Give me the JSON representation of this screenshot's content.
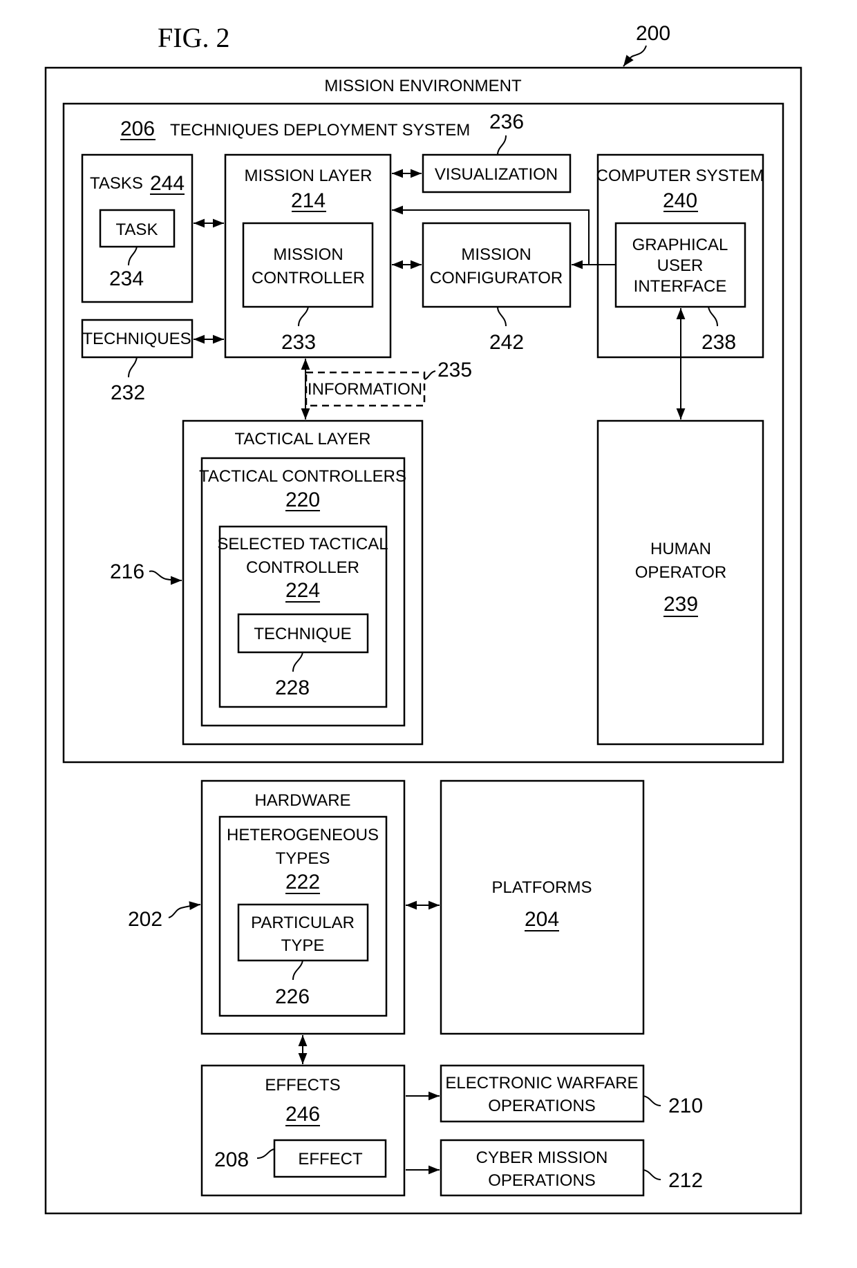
{
  "figure": {
    "title": "FIG. 2",
    "ref": "200"
  },
  "mission_environment": {
    "label": "MISSION ENVIRONMENT"
  },
  "techniques_deployment_system": {
    "ref": "206",
    "label": "TECHNIQUES DEPLOYMENT SYSTEM"
  },
  "tasks": {
    "label": "TASKS",
    "ref": "244",
    "task": {
      "label": "TASK",
      "ref": "234"
    }
  },
  "techniques": {
    "label": "TECHNIQUES",
    "ref": "232"
  },
  "mission_layer": {
    "label": "MISSION LAYER",
    "ref": "214",
    "mission_controller": {
      "line1": "MISSION",
      "line2": "CONTROLLER",
      "ref": "233"
    }
  },
  "visualization": {
    "label": "VISUALIZATION",
    "ref": "236"
  },
  "mission_configurator": {
    "line1": "MISSION",
    "line2": "CONFIGURATOR",
    "ref": "242"
  },
  "computer_system": {
    "label": "COMPUTER SYSTEM",
    "ref": "240",
    "gui": {
      "line1": "GRAPHICAL",
      "line2": "USER",
      "line3": "INTERFACE",
      "ref": "238"
    }
  },
  "information": {
    "label": "INFORMATION",
    "ref": "235"
  },
  "tactical_layer": {
    "label": "TACTICAL LAYER",
    "ref": "216",
    "tactical_controllers": {
      "label": "TACTICAL CONTROLLERS",
      "ref": "220"
    },
    "selected_controller": {
      "line1": "SELECTED TACTICAL",
      "line2": "CONTROLLER",
      "ref": "224"
    },
    "technique": {
      "label": "TECHNIQUE",
      "ref": "228"
    }
  },
  "human_operator": {
    "line1": "HUMAN",
    "line2": "OPERATOR",
    "ref": "239"
  },
  "hardware": {
    "label": "HARDWARE",
    "ref": "202",
    "heterogeneous_types": {
      "line1": "HETEROGENEOUS",
      "line2": "TYPES",
      "ref": "222"
    },
    "particular_type": {
      "line1": "PARTICULAR",
      "line2": "TYPE",
      "ref": "226"
    }
  },
  "platforms": {
    "label": "PLATFORMS",
    "ref": "204"
  },
  "effects": {
    "label": "EFFECTS",
    "ref": "246",
    "effect": {
      "label": "EFFECT",
      "ref": "208"
    }
  },
  "electronic_warfare": {
    "line1": "ELECTRONIC WARFARE",
    "line2": "OPERATIONS",
    "ref": "210"
  },
  "cyber_mission": {
    "line1": "CYBER MISSION",
    "line2": "OPERATIONS",
    "ref": "212"
  }
}
